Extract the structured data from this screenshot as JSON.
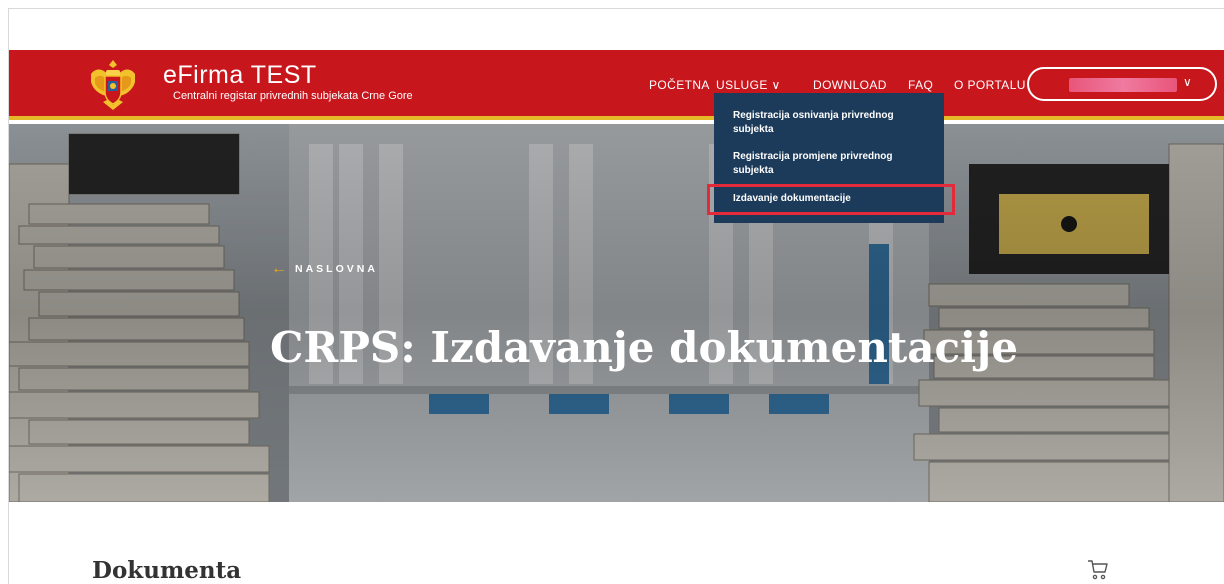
{
  "brand": {
    "title": "eFirma TEST",
    "subtitle": "Centralni registar privrednih subjekata Crne Gore"
  },
  "nav": {
    "items": [
      {
        "label": "POČETNA"
      },
      {
        "label": "USLUGE ∨"
      },
      {
        "label": "DOWNLOAD"
      },
      {
        "label": "FAQ"
      },
      {
        "label": "O PORTALU"
      }
    ],
    "language_chevron": "∨"
  },
  "dropdown": {
    "items": [
      {
        "label_line1": "Registracija osnivanja privrednog",
        "label_line2": "subjekta"
      },
      {
        "label_line1": "Registracija promjene privrednog",
        "label_line2": "subjekta"
      },
      {
        "label_line1": "Izdavanje dokumentacije",
        "label_line2": ""
      }
    ],
    "highlighted_index": 2
  },
  "hero": {
    "back_label": "NASLOVNA",
    "back_arrow": "←",
    "title": "CRPS: Izdavanje dokumentacije"
  },
  "content": {
    "section_title": "Dokumenta"
  },
  "icons": {
    "coat_of_arms": "montenegro-coat-of-arms-icon",
    "cart": "shopping-cart-icon",
    "back_arrow": "arrow-left-icon"
  },
  "colors": {
    "navbar": "#c8161d",
    "navbar_border": "#e4b826",
    "dropdown_bg": "#1c3a5a",
    "highlight_border": "#e22a3a",
    "back_arrow": "#f0a21b"
  }
}
